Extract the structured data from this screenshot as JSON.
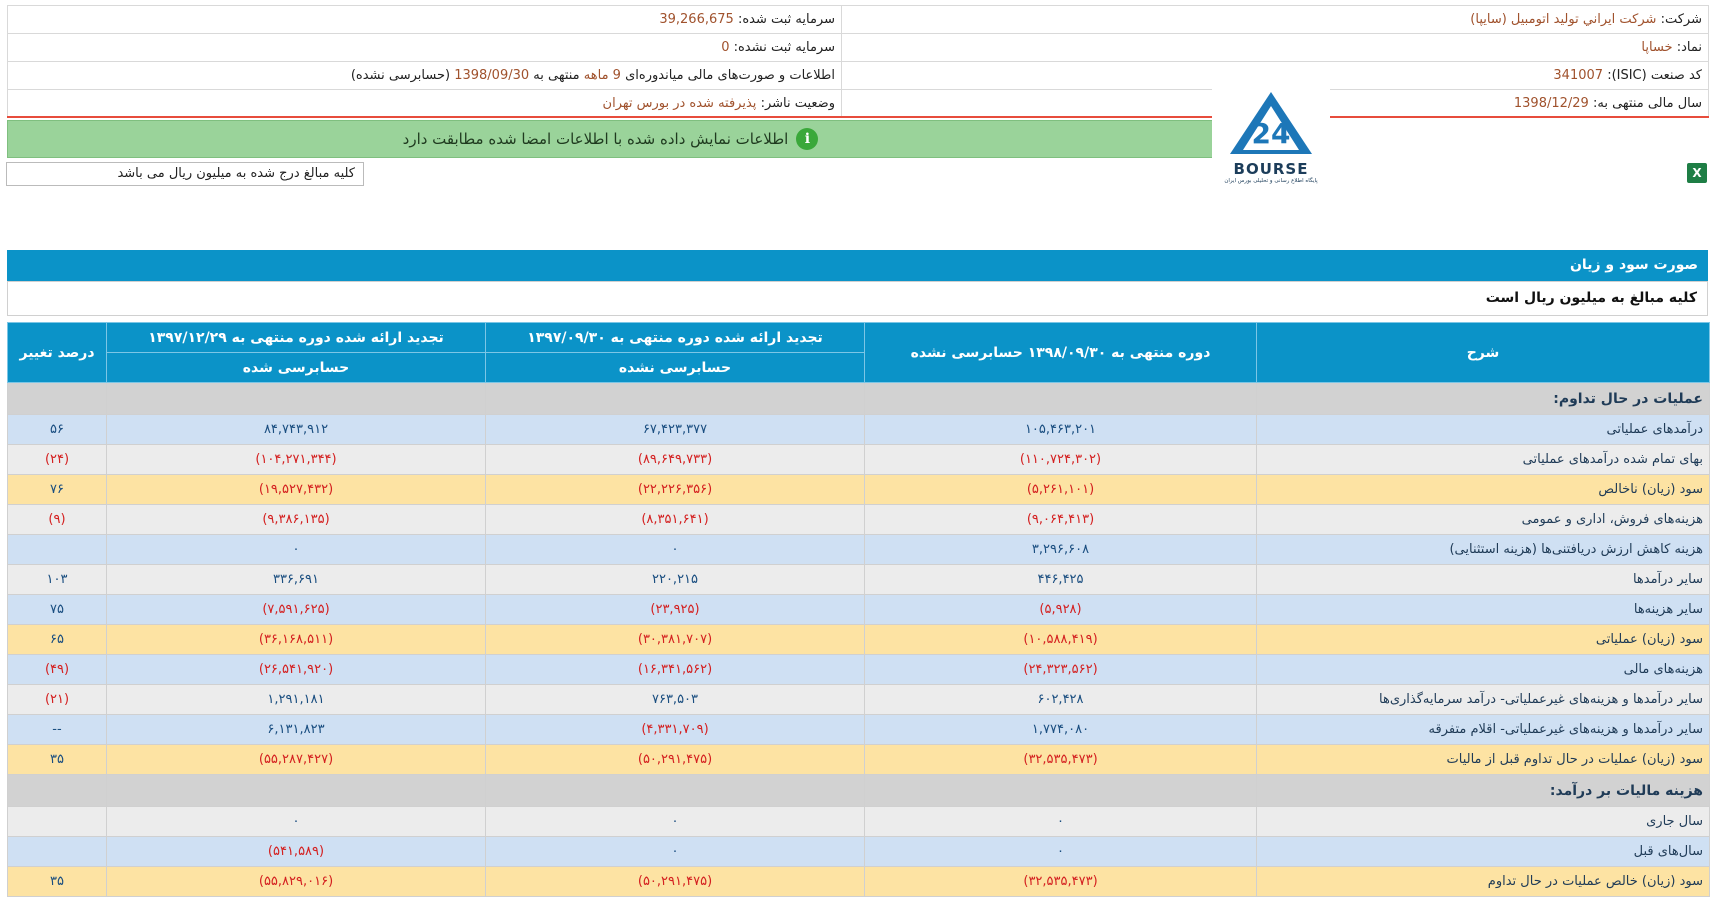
{
  "company_info": {
    "company_label": "شرکت:",
    "company_value": "شرکت ايراني توليد اتومبيل (سايپا)",
    "symbol_label": "نماد:",
    "symbol_value": "خساپا",
    "isic_label": "کد صنعت (ISIC):",
    "isic_value": "341007",
    "fiscal_year_label": "سال مالی منتهی به:",
    "fiscal_year_value": "1398/12/29",
    "registered_capital_label": "سرمایه ثبت شده:",
    "registered_capital_value": "39,266,675",
    "unregistered_capital_label": "سرمایه ثبت نشده:",
    "unregistered_capital_value": "0",
    "report_text_prefix": "اطلاعات و صورت‌های مالی میاندوره‌ای",
    "report_period": "9 ماهه",
    "report_text_mid": "منتهی به",
    "report_date": "1398/09/30",
    "report_status": "(حسابرسی نشده)",
    "publisher_status_label": "وضعیت ناشر:",
    "publisher_status_value": "پذیرفته شده در بورس تهران"
  },
  "notice": {
    "icon": "info-icon",
    "text": "اطلاعات نمایش داده شده با اطلاعات امضا شده مطابقت دارد"
  },
  "logo": {
    "word": "BOURSE",
    "tagline": "پایگاه اطلاع رسانی و تحلیلی بورس ایران"
  },
  "unit_note": "کلیه مبالغ درج شده به میلیون ریال می باشد",
  "section": {
    "title": "صورت سود و زیان",
    "note": "کلیه مبالغ به میلیون ریال است"
  },
  "table": {
    "headers": {
      "desc": "شرح",
      "col1_top": "دوره منتهی به ۱۳۹۸/۰۹/۳۰ حسابرسی نشده",
      "col2_top": "تجدید ارائه شده دوره منتهی به ۱۳۹۷/۰۹/۳۰",
      "col2_sub": "حسابرسی نشده",
      "col3_top": "تجدید ارائه شده دوره منتهی به ۱۳۹۷/۱۲/۲۹",
      "col3_sub": "حسابرسی شده",
      "change": "درصد تغییر"
    },
    "rows": [
      {
        "type": "section",
        "desc": "عملیات در حال تداوم:",
        "c1": "",
        "c2": "",
        "c3": "",
        "change": ""
      },
      {
        "type": "blue",
        "desc": "درآمدهای عملیاتی",
        "c1": "۱۰۵,۴۶۳,۲۰۱",
        "c2": "۶۷,۴۲۳,۳۷۷",
        "c3": "۸۴,۷۴۳,۹۱۲",
        "change": "۵۶"
      },
      {
        "type": "grey",
        "desc": "بهای تمام شده درآمدهای عملیاتی",
        "c1": "(۱۱۰,۷۲۴,۳۰۲)",
        "c2": "(۸۹,۶۴۹,۷۳۳)",
        "c3": "(۱۰۴,۲۷۱,۳۴۴)",
        "change": "(۲۴)"
      },
      {
        "type": "yellow",
        "desc": "سود (زیان) ناخالص",
        "c1": "(۵,۲۶۱,۱۰۱)",
        "c2": "(۲۲,۲۲۶,۳۵۶)",
        "c3": "(۱۹,۵۲۷,۴۳۲)",
        "change": "۷۶"
      },
      {
        "type": "grey",
        "desc": "هزینه‌های فروش، اداری و عمومی",
        "c1": "(۹,۰۶۴,۴۱۳)",
        "c2": "(۸,۳۵۱,۶۴۱)",
        "c3": "(۹,۳۸۶,۱۳۵)",
        "change": "(۹)"
      },
      {
        "type": "blue",
        "desc": "هزینه کاهش ارزش دریافتنی‌ها (هزینه استثنایی)",
        "c1": "۳,۲۹۶,۶۰۸",
        "c2": "۰",
        "c3": "۰",
        "change": ""
      },
      {
        "type": "grey",
        "desc": "سایر درآمدها",
        "c1": "۴۴۶,۴۲۵",
        "c2": "۲۲۰,۲۱۵",
        "c3": "۳۳۶,۶۹۱",
        "change": "۱۰۳"
      },
      {
        "type": "blue",
        "desc": "سایر هزینه‌ها",
        "c1": "(۵,۹۲۸)",
        "c2": "(۲۳,۹۲۵)",
        "c3": "(۷,۵۹۱,۶۲۵)",
        "change": "۷۵"
      },
      {
        "type": "yellow",
        "desc": "سود (زیان) عملیاتی",
        "c1": "(۱۰,۵۸۸,۴۱۹)",
        "c2": "(۳۰,۳۸۱,۷۰۷)",
        "c3": "(۳۶,۱۶۸,۵۱۱)",
        "change": "۶۵"
      },
      {
        "type": "blue",
        "desc": "هزینه‌های مالی",
        "c1": "(۲۴,۳۲۳,۵۶۲)",
        "c2": "(۱۶,۳۴۱,۵۶۲)",
        "c3": "(۲۶,۵۴۱,۹۲۰)",
        "change": "(۴۹)"
      },
      {
        "type": "grey",
        "desc": "سایر درآمدها و هزینه‌های غیرعملیاتی- درآمد سرمایه‌گذاری‌ها",
        "c1": "۶۰۲,۴۲۸",
        "c2": "۷۶۳,۵۰۳",
        "c3": "۱,۲۹۱,۱۸۱",
        "change": "(۲۱)"
      },
      {
        "type": "blue",
        "desc": "سایر درآمدها و هزینه‌های غیرعملیاتی- اقلام متفرقه",
        "c1": "۱,۷۷۴,۰۸۰",
        "c2": "(۴,۳۳۱,۷۰۹)",
        "c3": "۶,۱۳۱,۸۲۳",
        "change": "--"
      },
      {
        "type": "yellow",
        "desc": "سود (زیان) عملیات در حال تداوم قبل از مالیات",
        "c1": "(۳۲,۵۳۵,۴۷۳)",
        "c2": "(۵۰,۲۹۱,۴۷۵)",
        "c3": "(۵۵,۲۸۷,۴۲۷)",
        "change": "۳۵"
      },
      {
        "type": "section",
        "desc": "هزینه مالیات بر درآمد:",
        "c1": "",
        "c2": "",
        "c3": "",
        "change": ""
      },
      {
        "type": "grey",
        "desc": "سال جاری",
        "c1": "۰",
        "c2": "۰",
        "c3": "۰",
        "change": ""
      },
      {
        "type": "blue",
        "desc": "سال‌های قبل",
        "c1": "۰",
        "c2": "۰",
        "c3": "(۵۴۱,۵۸۹)",
        "change": ""
      },
      {
        "type": "yellow",
        "desc": "سود (زیان) خالص عملیات در حال تداوم",
        "c1": "(۳۲,۵۳۵,۴۷۳)",
        "c2": "(۵۰,۲۹۱,۴۷۵)",
        "c3": "(۵۵,۸۲۹,۰۱۶)",
        "change": "۳۵"
      }
    ]
  }
}
